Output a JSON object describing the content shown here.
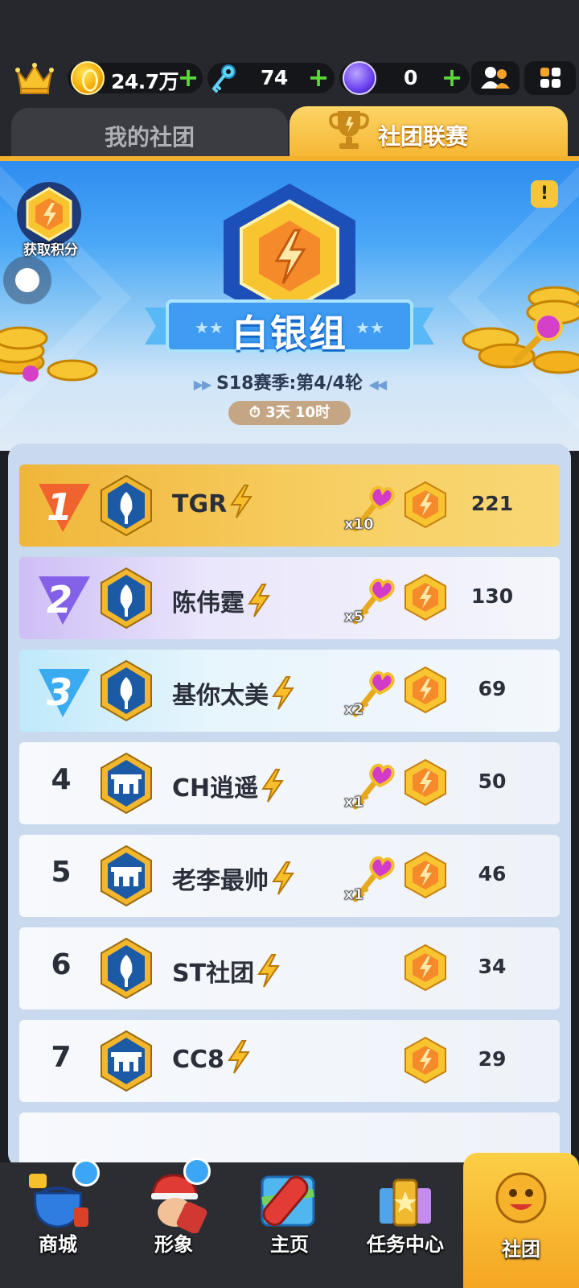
{
  "currency": {
    "coins": "24.7万",
    "keys": "74",
    "gems": "0"
  },
  "tabs": {
    "my_club": "我的社团",
    "club_league": "社团联赛"
  },
  "league": {
    "group": "白银组",
    "season": "S18赛季:第4/4轮",
    "timer": "3天 10时",
    "get_points": "获取积分",
    "info": "!"
  },
  "rankings": [
    {
      "rank": "1",
      "name": "TGR",
      "keys": "x10",
      "score": "221"
    },
    {
      "rank": "2",
      "name": "陈伟霆",
      "keys": "x5",
      "score": "130"
    },
    {
      "rank": "3",
      "name": "基你太美",
      "keys": "x2",
      "score": "69"
    },
    {
      "rank": "4",
      "name": "CH逍遥",
      "keys": "x1",
      "score": "50"
    },
    {
      "rank": "5",
      "name": "老李最帅",
      "keys": "x1",
      "score": "46"
    },
    {
      "rank": "6",
      "name": "ST社团",
      "keys": "",
      "score": "34"
    },
    {
      "rank": "7",
      "name": "CC8",
      "keys": "",
      "score": "29"
    }
  ],
  "nav": {
    "shop": "商城",
    "avatar": "形象",
    "home": "主页",
    "tasks": "任务中心",
    "club": "社团"
  },
  "colors": {
    "accent_gold": "#f5b531",
    "banner_blue": "#2f8cf0",
    "plus_green": "#5cd83a"
  }
}
